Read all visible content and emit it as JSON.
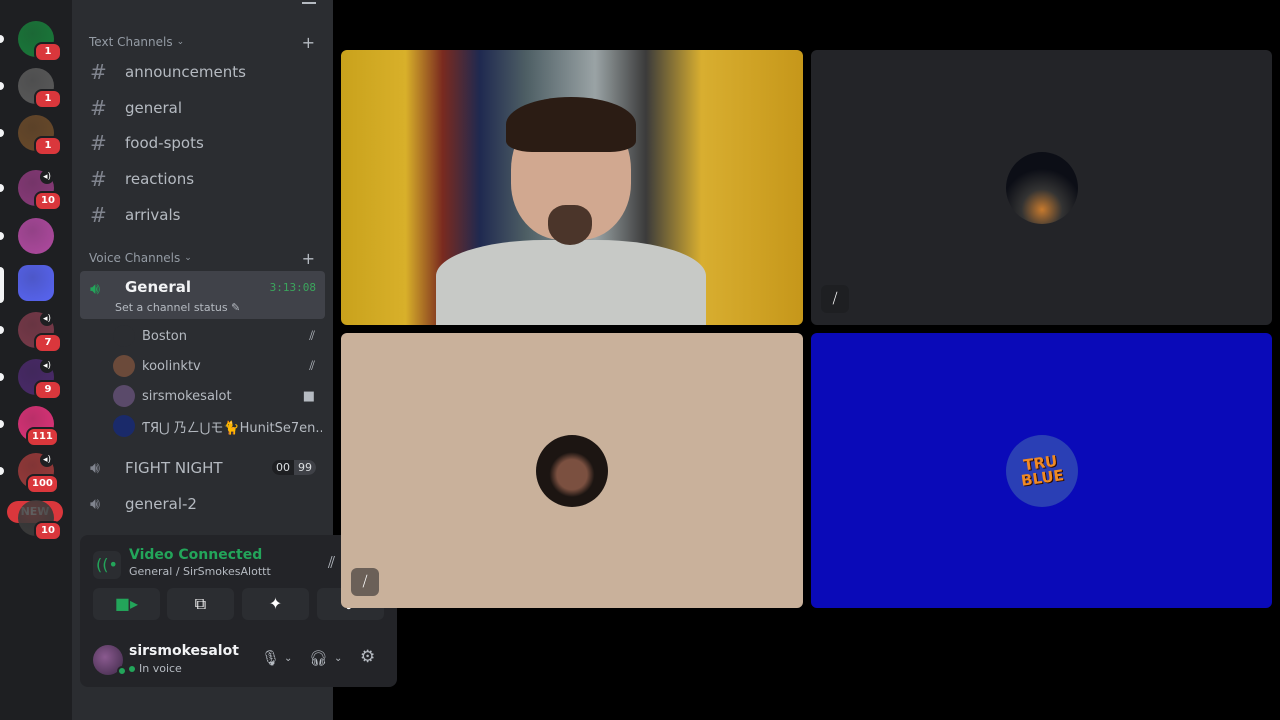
{
  "servers": [
    {
      "badge": "1",
      "color": "#1a7a3a",
      "speaker": false
    },
    {
      "badge": "1",
      "color": "#5a5a5a",
      "speaker": false
    },
    {
      "badge": "1",
      "color": "#6a4a2a",
      "speaker": false
    },
    {
      "badge": "10",
      "color": "#8a3a7a",
      "speaker": true
    },
    {
      "badge": "",
      "color": "#b04aa0",
      "speaker": false
    },
    {
      "badge": "",
      "color": "#5865f2",
      "speaker": false,
      "active": true
    },
    {
      "badge": "7",
      "color": "#7a3a4a",
      "speaker": true
    },
    {
      "badge": "9",
      "color": "#4a2a6a",
      "speaker": true
    },
    {
      "badge": "111",
      "color": "#e0337a",
      "speaker": false
    },
    {
      "badge": "100",
      "color": "#9a3a3a",
      "speaker": true
    },
    {
      "badge": "10",
      "color": "#3a3a3a",
      "speaker": false
    }
  ],
  "new_label": "NEW",
  "text_category": "Text Channels",
  "text_channels": [
    "announcements",
    "general",
    "food-spots",
    "reactions",
    "arrivals"
  ],
  "voice_category": "Voice Channels",
  "active_voice": {
    "name": "General",
    "timer": "3:13:08",
    "status": "Set a channel status"
  },
  "voice_users": [
    {
      "name": "Boston",
      "icon": "mic-off-icon"
    },
    {
      "name": "koolinktv",
      "icon": "mic-off-icon"
    },
    {
      "name": "sirsmokesalot",
      "icon": "video-icon"
    },
    {
      "name": "ƬЯ⋃ 乃ㄥ⋃モ🐈HunitSe7en...",
      "icon": ""
    }
  ],
  "other_voice": [
    {
      "name": "FIGHT NIGHT",
      "count_a": "00",
      "count_b": "99"
    },
    {
      "name": "general-2"
    }
  ],
  "voice_panel": {
    "title": "Video Connected",
    "subtitle": "General / SirSmokesAlottt"
  },
  "user": {
    "name": "sirsmokesalot",
    "status": "In voice"
  },
  "colors": {
    "green": "#23a55a",
    "accent": "#5865f2",
    "red": "#da373c"
  }
}
